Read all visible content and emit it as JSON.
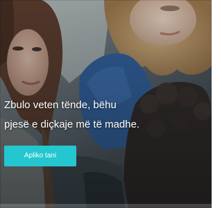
{
  "banner": {
    "headline_line1": "Zbulo veten tënde, bëhu",
    "headline_line2": "pjesë e diçkaje më të madhe.",
    "cta_label": "Apliko tani",
    "accent_color": "#24c6cf",
    "background_description_icon": "photo-of-students"
  }
}
